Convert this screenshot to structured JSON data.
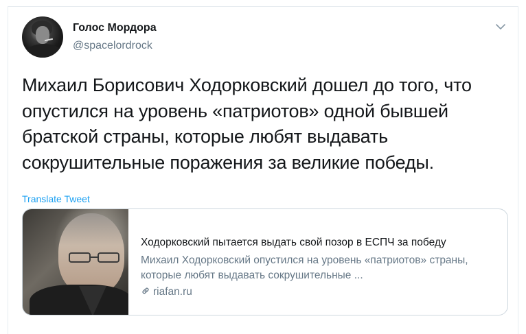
{
  "author": {
    "display_name": "Голос Мордора",
    "handle": "@spacelordrock"
  },
  "tweet": {
    "text": "Михаил Борисович Ходорковский дошел до того, что опустился на уровень «патриотов» одной бывшей братской страны, которые любят выдавать сокрушительные поражения за великие победы.",
    "translate_label": "Translate Tweet"
  },
  "card": {
    "title": "Ходорковский пытается выдать свой позор в ЕСПЧ за победу",
    "description": "Михаил Ходорковский опустился на уровень «патриотов» страны, которые любят выдавать сокрушительные ...",
    "domain": "riafan.ru"
  },
  "icons": {
    "menu": "chevron-down-icon",
    "link": "link-icon"
  },
  "colors": {
    "text_primary": "#14171a",
    "text_secondary": "#657786",
    "link_blue": "#1da1f2",
    "border": "#ccd6dd"
  }
}
